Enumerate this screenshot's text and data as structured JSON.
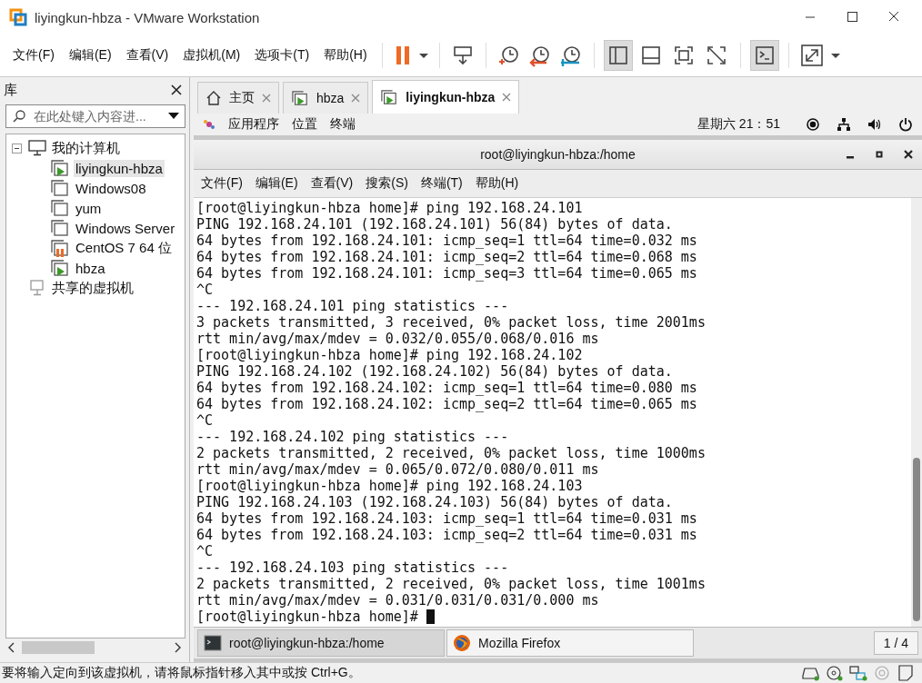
{
  "window": {
    "title": "liyingkun-hbza - VMware Workstation"
  },
  "menu": [
    "文件(F)",
    "编辑(E)",
    "查看(V)",
    "虚拟机(M)",
    "选项卡(T)",
    "帮助(H)"
  ],
  "view_buttons": [
    {
      "selected": true
    },
    {
      "selected": false
    },
    {
      "selected": false
    },
    {
      "selected": false
    }
  ],
  "console_button": {
    "selected": true
  },
  "library": {
    "title": "库",
    "search": {
      "placeholder": "在此处键入内容进..."
    },
    "tree": [
      {
        "label": "我的计算机",
        "kind": "computer",
        "expanded": true,
        "selected": false,
        "children": [
          {
            "label": "liyingkun-hbza",
            "kind": "running",
            "selected": true
          },
          {
            "label": "Windows08",
            "kind": "off",
            "selected": false
          },
          {
            "label": "yum",
            "kind": "off",
            "selected": false
          },
          {
            "label": "Windows Server",
            "kind": "off",
            "selected": false
          },
          {
            "label": "CentOS 7 64 位",
            "kind": "paused",
            "selected": false
          },
          {
            "label": "hbza",
            "kind": "running",
            "selected": false
          }
        ]
      },
      {
        "label": "共享的虚拟机",
        "kind": "shared",
        "selected": false
      }
    ]
  },
  "tabs": [
    {
      "label": "主页",
      "kind": "home",
      "selected": false
    },
    {
      "label": "hbza",
      "kind": "vm",
      "selected": false
    },
    {
      "label": "liyingkun-hbza",
      "kind": "vm",
      "selected": true
    }
  ],
  "guest_topbar": {
    "items": [
      "应用程序",
      "位置",
      "终端"
    ],
    "clock": "星期六  21：51"
  },
  "terminal": {
    "title": "root@liyingkun-hbza:/home",
    "menu": [
      "文件(F)",
      "编辑(E)",
      "查看(V)",
      "搜索(S)",
      "终端(T)",
      "帮助(H)"
    ],
    "lines": [
      "[root@liyingkun-hbza home]# ping 192.168.24.101",
      "PING 192.168.24.101 (192.168.24.101) 56(84) bytes of data.",
      "64 bytes from 192.168.24.101: icmp_seq=1 ttl=64 time=0.032 ms",
      "64 bytes from 192.168.24.101: icmp_seq=2 ttl=64 time=0.068 ms",
      "64 bytes from 192.168.24.101: icmp_seq=3 ttl=64 time=0.065 ms",
      "^C",
      "--- 192.168.24.101 ping statistics ---",
      "3 packets transmitted, 3 received, 0% packet loss, time 2001ms",
      "rtt min/avg/max/mdev = 0.032/0.055/0.068/0.016 ms",
      "[root@liyingkun-hbza home]# ping 192.168.24.102",
      "PING 192.168.24.102 (192.168.24.102) 56(84) bytes of data.",
      "64 bytes from 192.168.24.102: icmp_seq=1 ttl=64 time=0.080 ms",
      "64 bytes from 192.168.24.102: icmp_seq=2 ttl=64 time=0.065 ms",
      "^C",
      "--- 192.168.24.102 ping statistics ---",
      "2 packets transmitted, 2 received, 0% packet loss, time 1000ms",
      "rtt min/avg/max/mdev = 0.065/0.072/0.080/0.011 ms",
      "[root@liyingkun-hbza home]# ping 192.168.24.103",
      "PING 192.168.24.103 (192.168.24.103) 56(84) bytes of data.",
      "64 bytes from 192.168.24.103: icmp_seq=1 ttl=64 time=0.031 ms",
      "64 bytes from 192.168.24.103: icmp_seq=2 ttl=64 time=0.031 ms",
      "^C",
      "--- 192.168.24.103 ping statistics ---",
      "2 packets transmitted, 2 received, 0% packet loss, time 1001ms",
      "rtt min/avg/max/mdev = 0.031/0.031/0.031/0.000 ms",
      "[root@liyingkun-hbza home]# "
    ]
  },
  "taskbar": {
    "items": [
      {
        "label": "root@liyingkun-hbza:/home",
        "kind": "terminal",
        "selected": true
      },
      {
        "label": "Mozilla Firefox",
        "kind": "firefox",
        "selected": false
      }
    ],
    "pager": "1 / 4"
  },
  "status_bar": {
    "text": "要将输入定向到该虚拟机，请将鼠标指针移入其中或按 Ctrl+G。"
  }
}
